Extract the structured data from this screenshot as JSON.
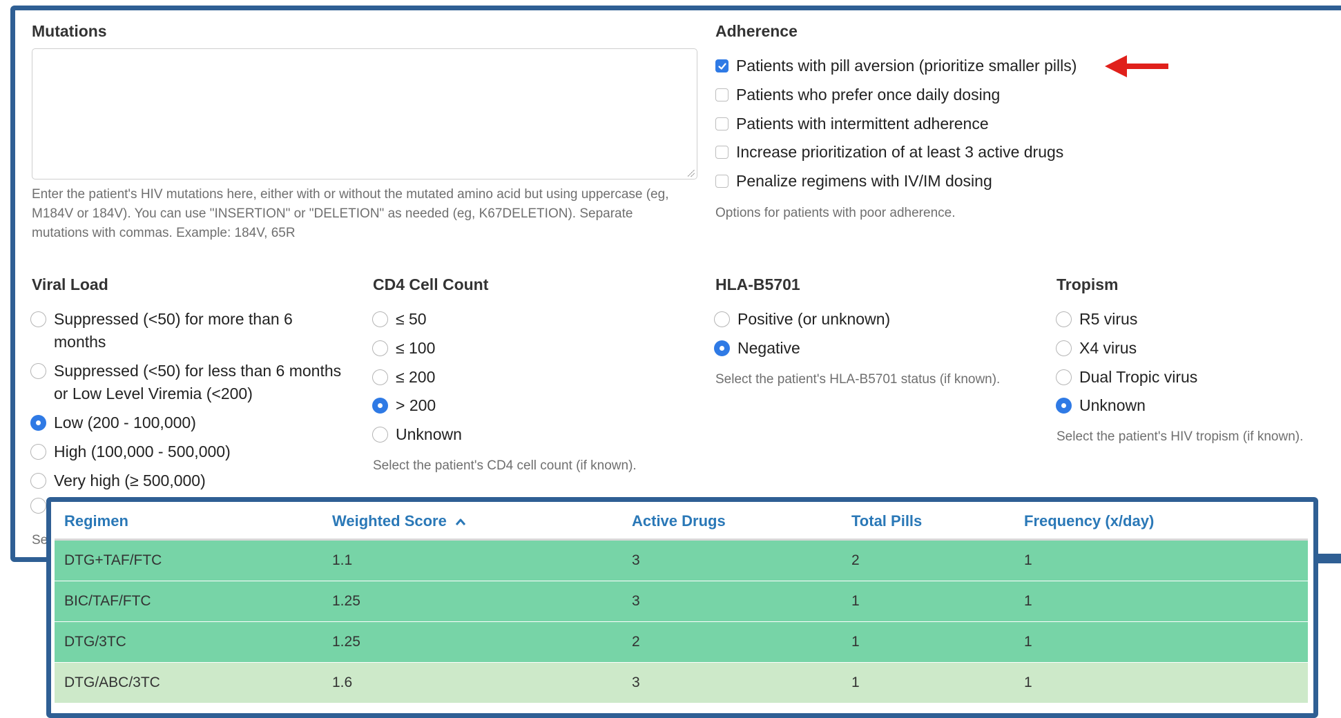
{
  "mutations": {
    "title": "Mutations",
    "value": "",
    "help": "Enter the patient's HIV mutations here, either with or without the mutated amino acid but using uppercase (eg, M184V or 184V). You can use \"INSERTION\" or \"DELETION\" as needed (eg, K67DELETION). Separate mutations with commas. Example: 184V, 65R"
  },
  "adherence": {
    "title": "Adherence",
    "options": [
      {
        "label": "Patients with pill aversion (prioritize smaller pills)",
        "checked": true
      },
      {
        "label": "Patients who prefer once daily dosing",
        "checked": false
      },
      {
        "label": "Patients with intermittent adherence",
        "checked": false
      },
      {
        "label": "Increase prioritization of at least 3 active drugs",
        "checked": false
      },
      {
        "label": "Penalize regimens with IV/IM dosing",
        "checked": false
      }
    ],
    "help": "Options for patients with poor adherence."
  },
  "viral_load": {
    "title": "Viral Load",
    "options": [
      {
        "label": "Suppressed (<50) for more than 6 months",
        "selected": false
      },
      {
        "label": "Suppressed (<50) for less than 6 months or Low Level Viremia (<200)",
        "selected": false
      },
      {
        "label": "Low (200 - 100,000)",
        "selected": true
      },
      {
        "label": "High (100,000 - 500,000)",
        "selected": false
      },
      {
        "label": "Very high (≥ 500,000)",
        "selected": false
      }
    ],
    "help_partial": "Se"
  },
  "cd4": {
    "title": "CD4 Cell Count",
    "options": [
      {
        "label": "≤ 50",
        "selected": false
      },
      {
        "label": "≤ 100",
        "selected": false
      },
      {
        "label": "≤ 200",
        "selected": false
      },
      {
        "label": "> 200",
        "selected": true
      },
      {
        "label": "Unknown",
        "selected": false
      }
    ],
    "help": "Select the patient's CD4 cell count (if known)."
  },
  "hla": {
    "title": "HLA-B5701",
    "options": [
      {
        "label": "Positive (or unknown)",
        "selected": false
      },
      {
        "label": "Negative",
        "selected": true
      }
    ],
    "help": "Select the patient's HLA-B5701 status (if known)."
  },
  "tropism": {
    "title": "Tropism",
    "options": [
      {
        "label": "R5 virus",
        "selected": false
      },
      {
        "label": "X4 virus",
        "selected": false
      },
      {
        "label": "Dual Tropic virus",
        "selected": false
      },
      {
        "label": "Unknown",
        "selected": true
      }
    ],
    "help": "Select the patient's HIV tropism (if known)."
  },
  "results": {
    "headers": [
      "Regimen",
      "Weighted Score",
      "Active Drugs",
      "Total Pills",
      "Frequency (x/day)"
    ],
    "sort_indicator": "^",
    "rows": [
      {
        "cells": [
          "DTG+TAF/FTC",
          "1.1",
          "3",
          "2",
          "1"
        ],
        "color": "#77d4a7"
      },
      {
        "cells": [
          "BIC/TAF/FTC",
          "1.25",
          "3",
          "1",
          "1"
        ],
        "color": "#77d4a7"
      },
      {
        "cells": [
          "DTG/3TC",
          "1.25",
          "2",
          "1",
          "1"
        ],
        "color": "#77d4a7"
      },
      {
        "cells": [
          "DTG/ABC/3TC",
          "1.6",
          "3",
          "1",
          "1"
        ],
        "color": "#cde9c9"
      }
    ]
  },
  "colors": {
    "frame": "#2f5f94",
    "accent": "#2f7ae5",
    "link": "#2a78b7",
    "annotation_arrow": "#e0201b"
  }
}
